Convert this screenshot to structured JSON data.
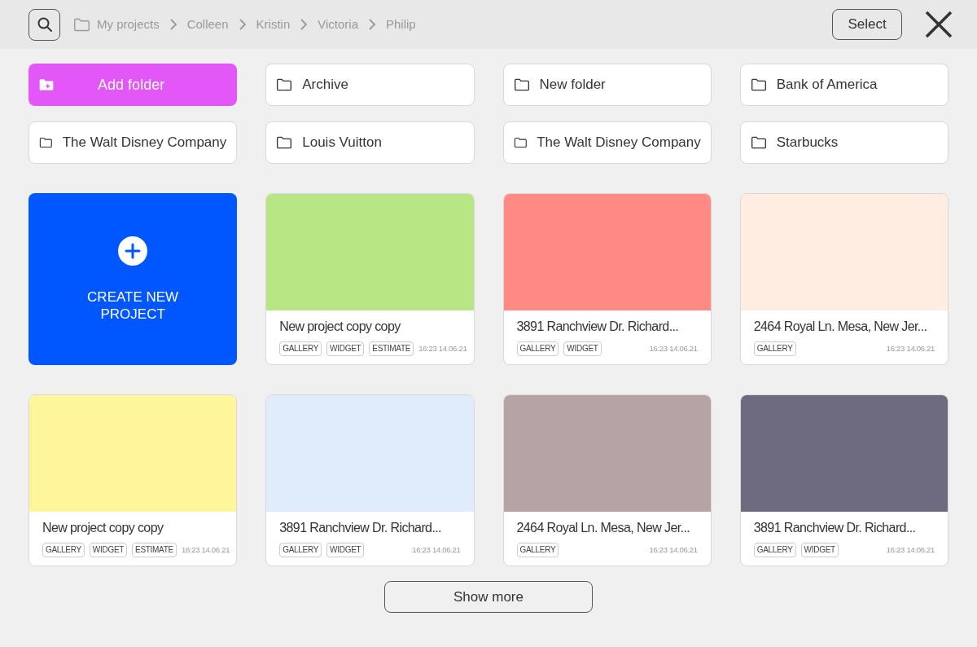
{
  "breadcrumbs": [
    "My projects",
    "Colleen",
    "Kristin",
    "Victoria",
    "Philip"
  ],
  "select_button": "Select",
  "folders": [
    {
      "kind": "add",
      "label": "Add folder"
    },
    {
      "kind": "folder",
      "label": "Archive"
    },
    {
      "kind": "folder",
      "label": "New folder"
    },
    {
      "kind": "folder",
      "label": "Bank of America"
    },
    {
      "kind": "folder",
      "label": "The Walt Disney Company"
    },
    {
      "kind": "folder",
      "label": "Louis Vuitton"
    },
    {
      "kind": "folder",
      "label": "The Walt Disney Company"
    },
    {
      "kind": "folder",
      "label": "Starbucks"
    }
  ],
  "projects": [
    {
      "kind": "create",
      "label": "CREATE NEW PROJECT"
    },
    {
      "kind": "project",
      "color": "#b8e684",
      "title": "New project copy copy",
      "tags": [
        "GALLERY",
        "WIDGET",
        "ESTIMATE"
      ],
      "time": "16:23 14.06.21"
    },
    {
      "kind": "project",
      "color": "#ff8983",
      "title": "3891 Ranchview Dr. Richard...",
      "tags": [
        "GALLERY",
        "WIDGET"
      ],
      "time": "16:23 14.06.21"
    },
    {
      "kind": "project",
      "color": "#ffede1",
      "title": "2464 Royal Ln. Mesa, New Jer...",
      "tags": [
        "GALLERY"
      ],
      "time": "16:23 14.06.21"
    },
    {
      "kind": "project",
      "color": "#fff59b",
      "title": "New project copy copy",
      "tags": [
        "GALLERY",
        "WIDGET",
        "ESTIMATE"
      ],
      "time": "16:23 14.06.21"
    },
    {
      "kind": "project",
      "color": "#deecfc",
      "title": "3891 Ranchview Dr. Richard...",
      "tags": [
        "GALLERY",
        "WIDGET"
      ],
      "time": "16:23 14.06.21"
    },
    {
      "kind": "project",
      "color": "#b6a4a4",
      "title": "2464 Royal Ln. Mesa, New Jer...",
      "tags": [
        "GALLERY"
      ],
      "time": "16:23 14.06.21"
    },
    {
      "kind": "project",
      "color": "#6e6b80",
      "title": "3891 Ranchview Dr. Richard...",
      "tags": [
        "GALLERY",
        "WIDGET"
      ],
      "time": "16:23 14.06.21"
    }
  ],
  "show_more": "Show more"
}
